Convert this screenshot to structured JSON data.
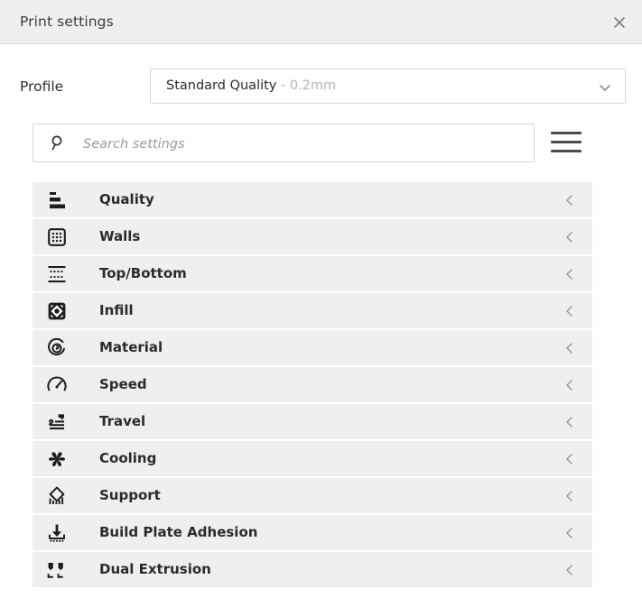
{
  "window": {
    "title": "Print settings",
    "close_icon": "close-icon"
  },
  "profile": {
    "label": "Profile",
    "selected_name": "Standard Quality",
    "selected_suffix": "- 0.2mm",
    "caret_icon": "chevron-down-icon"
  },
  "search": {
    "placeholder": "Search settings",
    "value": "",
    "icon": "search-icon",
    "menu_icon": "hamburger-menu-icon"
  },
  "colors": {
    "titlebar_bg": "#efefef",
    "row_bg": "#efefef",
    "page_bg": "#ffffff",
    "text": "#2b2b2b",
    "muted_text": "#b5b5b5",
    "border": "#d6d6d6",
    "chevron": "#9a9a9a"
  },
  "settings": {
    "collapse_icon": "chevron-left-icon",
    "categories": [
      {
        "label": "Quality",
        "icon": "quality-icon",
        "expanded": false
      },
      {
        "label": "Walls",
        "icon": "walls-icon",
        "expanded": false
      },
      {
        "label": "Top/Bottom",
        "icon": "top-bottom-icon",
        "expanded": false
      },
      {
        "label": "Infill",
        "icon": "infill-icon",
        "expanded": false
      },
      {
        "label": "Material",
        "icon": "material-icon",
        "expanded": false
      },
      {
        "label": "Speed",
        "icon": "speed-icon",
        "expanded": false
      },
      {
        "label": "Travel",
        "icon": "travel-icon",
        "expanded": false
      },
      {
        "label": "Cooling",
        "icon": "cooling-icon",
        "expanded": false
      },
      {
        "label": "Support",
        "icon": "support-icon",
        "expanded": false
      },
      {
        "label": "Build Plate Adhesion",
        "icon": "build-plate-adhesion-icon",
        "expanded": false
      },
      {
        "label": "Dual Extrusion",
        "icon": "dual-extrusion-icon",
        "expanded": false
      }
    ]
  }
}
